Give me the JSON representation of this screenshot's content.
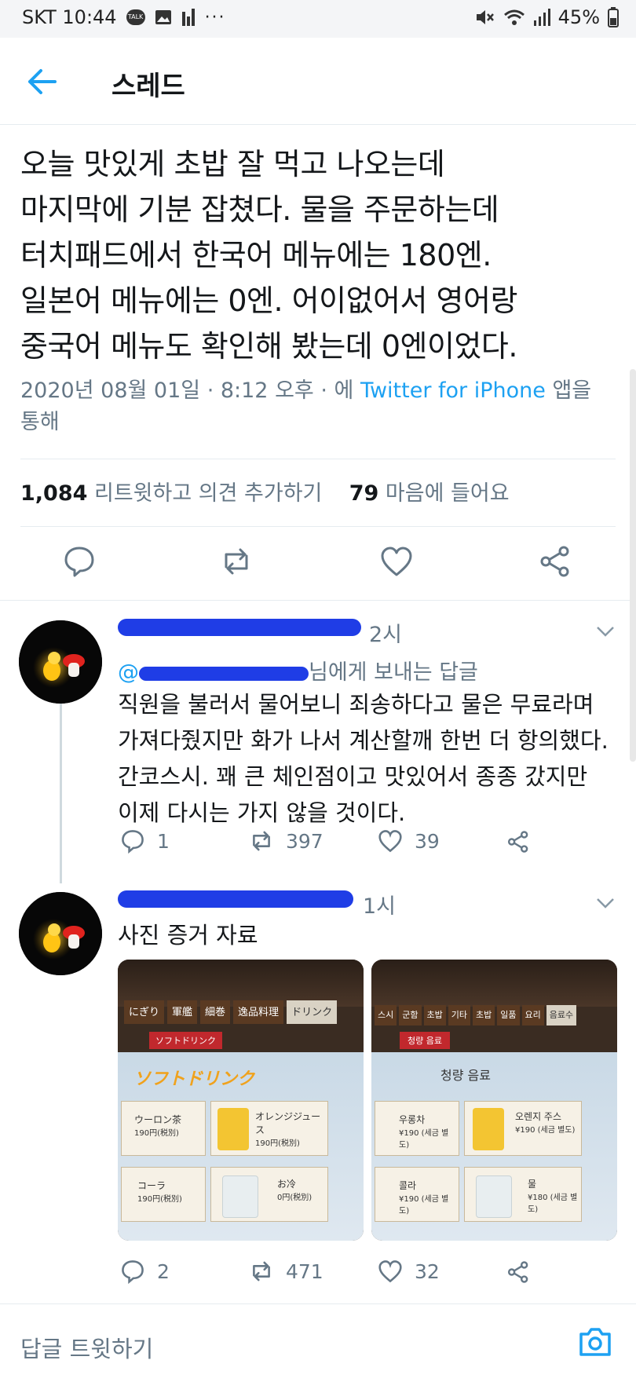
{
  "status": {
    "carrier_time": "SKT 10:44",
    "battery": "45%",
    "icons": [
      "talk-icon",
      "gallery-icon",
      "signal-bars-icon",
      "more-icon",
      "mute-icon",
      "wifi-icon",
      "cell-signal-icon",
      "battery-icon"
    ]
  },
  "header": {
    "title": "스레드",
    "back_icon": "arrow-left-icon"
  },
  "tweet": {
    "lines": [
      "오늘 맛있게 초밥 잘 먹고 나오는데",
      "마지막에 기분 잡쳤다. 물을 주문하는데",
      "터치패드에서 한국어 메뉴에는 180엔.",
      "일본어 메뉴에는 0엔. 어이없어서 영어랑",
      "중국어 메뉴도 확인해 봤는데 0엔이었다."
    ],
    "meta_prefix": "2020년 08월 01일 · 8:12 오후 · 에 ",
    "meta_link": "Twitter for iPhone",
    "meta_suffix_line1": " 앱을",
    "meta_suffix_line2": "통해",
    "retweets_count": "1,084",
    "retweets_label": " 리트윗하고 의견 추가하기",
    "likes_count": "79",
    "likes_label": " 마음에 들어요"
  },
  "replies": [
    {
      "time": "2시",
      "replying_to": "님에게 보내는 답글",
      "lines": [
        "직원을 불러서 물어보니 죄송하다고 물은 무료라며",
        "가져다줬지만 화가 나서 계산할깨 한번 더 항의했다.",
        "간코스시. 꽤 큰 체인점이고 맛있어서 종종 갔지만",
        "이제 다시는 가지 않을 것이다."
      ],
      "reply_count": "1",
      "retweet_count": "397",
      "like_count": "39"
    },
    {
      "time": "1시",
      "lines": [
        "사진 증거 자료"
      ],
      "reply_count": "2",
      "retweet_count": "471",
      "like_count": "32",
      "photo_left": {
        "tabs": [
          "にぎり",
          "軍艦",
          "細巻",
          "逸品料理",
          "ドリンク"
        ],
        "subtab": "ソフトドリンク",
        "heading": "ソフトドリンク",
        "items": [
          {
            "name": "ウーロン茶",
            "price": "190円(税別)"
          },
          {
            "name": "オレンジジュース",
            "price": "190円(税別)"
          },
          {
            "name": "コーラ",
            "price": "190円(税別)"
          },
          {
            "name": "お冷",
            "price": "0円(税別)"
          }
        ]
      },
      "photo_right": {
        "tabs": [
          "스시",
          "군함",
          "초밥",
          "기타",
          "초밥",
          "일품",
          "요리",
          "음료수"
        ],
        "subtab": "청량 음료",
        "heading": "청량 음료",
        "items": [
          {
            "name": "우롱차",
            "price": "¥190 (세금 별도)"
          },
          {
            "name": "오렌지 주스",
            "price": "¥190 (세금 별도)"
          },
          {
            "name": "콜라",
            "price": "¥190 (세금 별도)"
          },
          {
            "name": "물",
            "price": "¥180 (세금 별도)"
          }
        ]
      }
    }
  ],
  "compose": {
    "placeholder": "답글 트윗하기"
  },
  "colors": {
    "link": "#1da1f2",
    "muted": "#657786",
    "text": "#14171a",
    "redaction": "#1f3de6"
  }
}
